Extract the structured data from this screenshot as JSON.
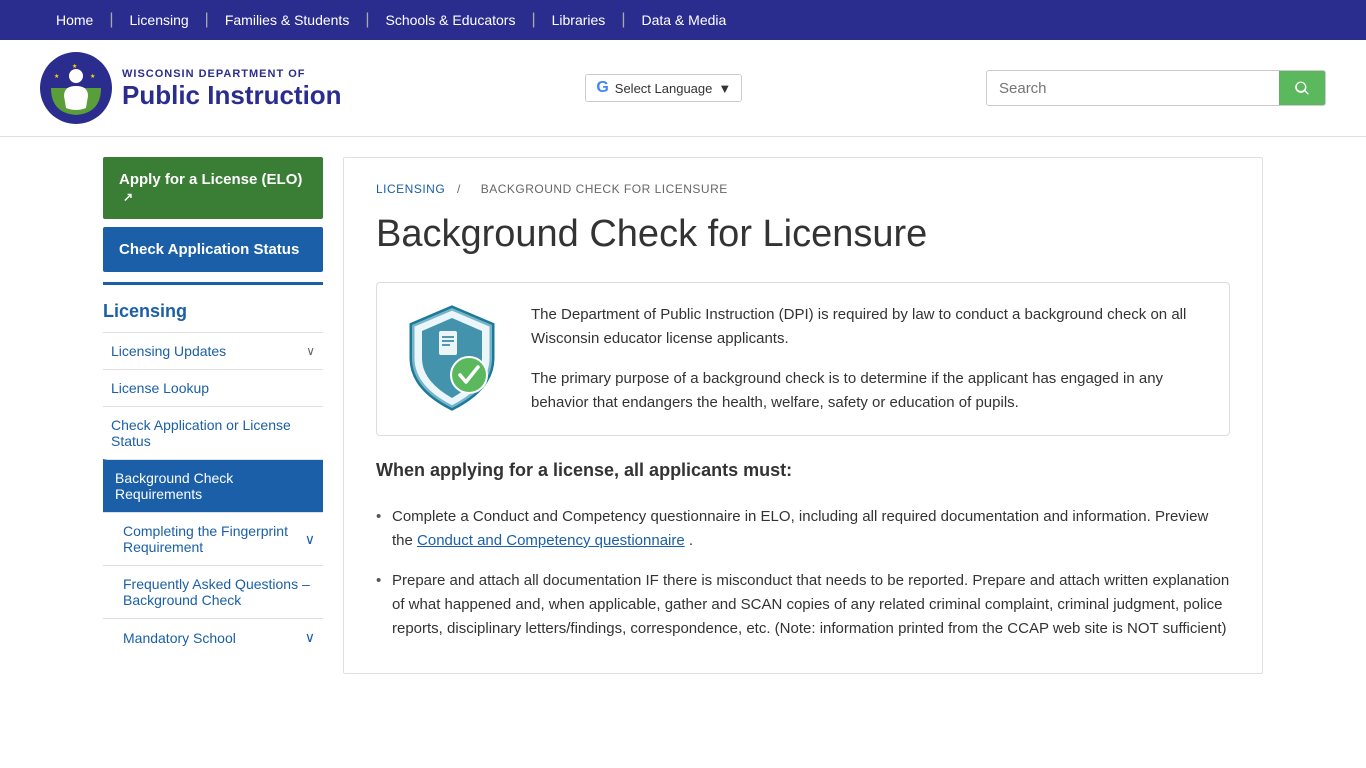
{
  "topnav": {
    "items": [
      {
        "label": "Home",
        "id": "home"
      },
      {
        "label": "Licensing",
        "id": "licensing"
      },
      {
        "label": "Families & Students",
        "id": "families"
      },
      {
        "label": "Schools & Educators",
        "id": "schools"
      },
      {
        "label": "Libraries",
        "id": "libraries"
      },
      {
        "label": "Data & Media",
        "id": "data"
      }
    ]
  },
  "header": {
    "logo_dept": "WISCONSIN DEPARTMENT OF",
    "logo_main": "Public Instruction",
    "language_label": "Select Language",
    "search_placeholder": "Search"
  },
  "sidebar": {
    "btn_apply": "Apply for a License (ELO)",
    "btn_check": "Check Application Status",
    "section_title": "Licensing",
    "items": [
      {
        "label": "Licensing Updates",
        "id": "licensing-updates",
        "has_chevron": true,
        "active": false,
        "sub": false
      },
      {
        "label": "License Lookup",
        "id": "license-lookup",
        "has_chevron": false,
        "active": false,
        "sub": false
      },
      {
        "label": "Check Application or License Status",
        "id": "check-app-status",
        "has_chevron": false,
        "active": false,
        "sub": false
      },
      {
        "label": "Background Check Requirements",
        "id": "bg-check-req",
        "has_chevron": false,
        "active": true,
        "sub": false
      },
      {
        "label": "Completing the Fingerprint Requirement",
        "id": "fingerprint",
        "has_chevron": true,
        "active": false,
        "sub": true
      },
      {
        "label": "Frequently Asked Questions – Background Check",
        "id": "faq-bg",
        "has_chevron": false,
        "active": false,
        "sub": true
      },
      {
        "label": "Mandatory School",
        "id": "mandatory-school",
        "has_chevron": true,
        "active": false,
        "sub": true
      }
    ]
  },
  "breadcrumb": {
    "items": [
      {
        "label": "LICENSING",
        "id": "bc-licensing"
      },
      {
        "label": "BACKGROUND CHECK FOR LICENSURE",
        "id": "bc-bgcheck"
      }
    ]
  },
  "content": {
    "page_title": "Background Check for Licensure",
    "info_para1": "The Department of Public Instruction (DPI) is required by law to conduct a background check on all Wisconsin educator license applicants.",
    "info_para2": "The primary purpose of a background check is to determine if the applicant has engaged in any behavior that endangers the health, welfare, safety or education of pupils.",
    "section_heading": "When applying for a license, all applicants must:",
    "list_items": [
      {
        "text": "Complete a Conduct and Competency questionnaire in ELO, including all required documentation and information. Preview the ",
        "link_label": "Conduct and Competency questionnaire",
        "link_after": ".",
        "id": "li-1"
      },
      {
        "text": "Prepare and attach all documentation IF there is misconduct that needs to be reported. Prepare and attach written explanation of what happened and, when applicable, gather and SCAN copies of any related criminal complaint, criminal judgment, police reports, disciplinary letters/findings, correspondence, etc. (Note: information printed from the CCAP web site is NOT sufficient)",
        "link_label": "",
        "link_after": "",
        "id": "li-2"
      }
    ]
  }
}
